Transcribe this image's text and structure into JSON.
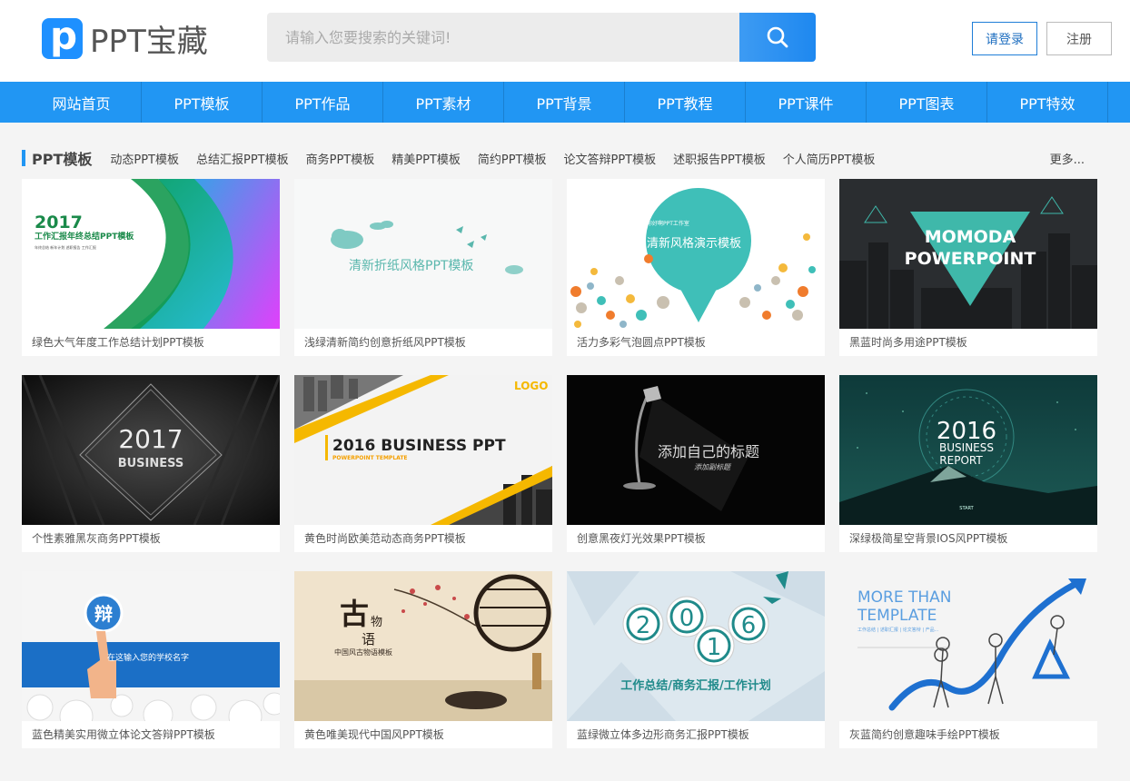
{
  "header": {
    "logo_text": "PPT宝藏",
    "logo_letter": "p",
    "search_placeholder": "请输入您要搜索的关键词!",
    "login_label": "请登录",
    "register_label": "注册"
  },
  "nav": {
    "items": [
      "网站首页",
      "PPT模板",
      "PPT作品",
      "PPT素材",
      "PPT背景",
      "PPT教程",
      "PPT课件",
      "PPT图表",
      "PPT特效"
    ]
  },
  "category": {
    "title": "PPT模板",
    "links": [
      "动态PPT模板",
      "总结汇报PPT模板",
      "商务PPT模板",
      "精美PPT模板",
      "简约PPT模板",
      "论文答辩PPT模板",
      "述职报告PPT模板",
      "个人简历PPT模板"
    ],
    "more": "更多..."
  },
  "cards": [
    {
      "title": "绿色大气年度工作总结计划PPT模板",
      "thumb": {
        "big": "2017",
        "line1": "工作汇报年终总结PPT模板",
        "line2": "年终总结 新年计划 述职报告 工作汇报"
      }
    },
    {
      "title": "浅绿清新简约创意折纸风PPT模板",
      "thumb": {
        "text": "清新折纸风格PPT模板"
      }
    },
    {
      "title": "活力多彩气泡圆点PPT模板",
      "thumb": {
        "small": "你好啊PPT工作室",
        "text": "清新风格演示模板"
      }
    },
    {
      "title": "黑蓝时尚多用途PPT模板",
      "thumb": {
        "line1": "MOMODA",
        "line2": "POWERPOINT"
      }
    },
    {
      "title": "个性素雅黑灰商务PPT模板",
      "thumb": {
        "big": "2017",
        "sub": "BUSINESS"
      }
    },
    {
      "title": "黄色时尚欧美范动态商务PPT模板",
      "thumb": {
        "logo": "LOGO",
        "big": "2016 BUSINESS PPT",
        "sub": "POWERPOINT TEMPLATE"
      }
    },
    {
      "title": "创意黑夜灯光效果PPT模板",
      "thumb": {
        "text": "添加自己的标题",
        "sub": "添加副标题"
      }
    },
    {
      "title": "深绿极简星空背景IOS风PPT模板",
      "thumb": {
        "big": "2016",
        "line1": "BUSINESS",
        "line2": "REPORT",
        "start": "START"
      }
    },
    {
      "title": "蓝色精美实用微立体论文答辩PPT模板",
      "thumb": {
        "char": "辩",
        "text": "在这输入您的学校名字"
      }
    },
    {
      "title": "黄色唯美现代中国风PPT模板",
      "thumb": {
        "c1": "古",
        "c2": "物",
        "c3": "语",
        "text": "中国风古物语模板"
      }
    },
    {
      "title": "蓝绿微立体多边形商务汇报PPT模板",
      "thumb": {
        "d1": "2",
        "d2": "0",
        "d3": "1",
        "d4": "6",
        "text": "工作总结/商务汇报/工作计划"
      }
    },
    {
      "title": "灰蓝简约创意趣味手绘PPT模板",
      "thumb": {
        "line1": "MORE THAN",
        "line2": "TEMPLATE",
        "small": "工作总结 | 述职汇报 | 论文答辩 | 产品..."
      }
    }
  ],
  "colors": {
    "brand_blue": "#2196f3",
    "nav_blue": "#2196f3",
    "page_bg": "#f4f4f4"
  },
  "icons": {
    "search": "search-icon",
    "logo": "ppt-logo-icon"
  }
}
